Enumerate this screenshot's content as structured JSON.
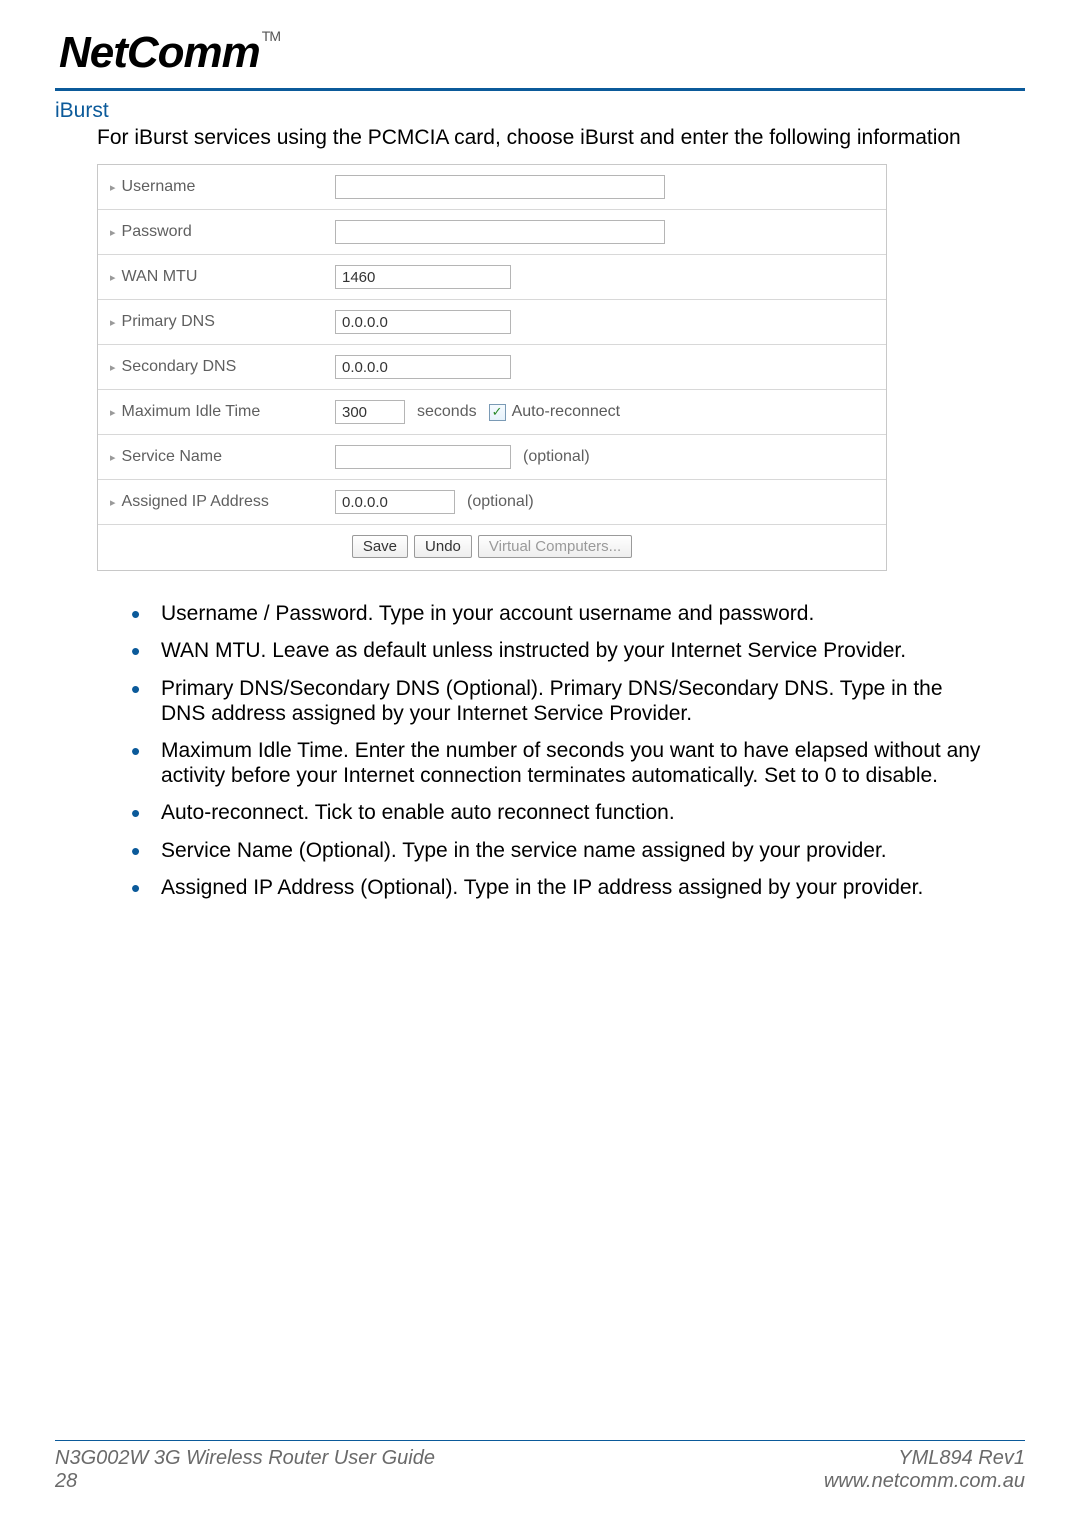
{
  "logo": {
    "text": "NetComm",
    "tm": "TM"
  },
  "section": {
    "title": "iBurst",
    "intro": "For iBurst services using the PCMCIA card, choose iBurst and enter the following information"
  },
  "form": {
    "rows": {
      "username": {
        "label": "Username",
        "value": ""
      },
      "password": {
        "label": "Password",
        "value": ""
      },
      "wan_mtu": {
        "label": "WAN MTU",
        "value": "1460"
      },
      "primary_dns": {
        "label": "Primary DNS",
        "value": "0.0.0.0"
      },
      "secondary_dns": {
        "label": "Secondary DNS",
        "value": "0.0.0.0"
      },
      "max_idle": {
        "label": "Maximum Idle Time",
        "value": "300",
        "suffix": "seconds",
        "checkbox_label": "Auto-reconnect",
        "checked": true
      },
      "service_name": {
        "label": "Service Name",
        "value": "",
        "optional": "(optional)"
      },
      "assigned_ip": {
        "label": "Assigned IP Address",
        "value": "0.0.0.0",
        "optional": "(optional)"
      }
    },
    "buttons": {
      "save": "Save",
      "undo": "Undo",
      "virtual": "Virtual Computers..."
    }
  },
  "bullets": [
    "Username / Password. Type in your account username and password.",
    "WAN MTU. Leave as default unless instructed by your Internet Service Provider.",
    "Primary DNS/Secondary DNS (Optional). Primary DNS/Secondary DNS. Type in the DNS address assigned by your Internet Service Provider.",
    "Maximum Idle Time. Enter the number of seconds you want to have elapsed without any activity before your Internet connection terminates automatically. Set to 0 to disable.",
    "Auto-reconnect. Tick to enable auto reconnect function.",
    "Service Name (Optional). Type in the service name assigned by your provider.",
    "Assigned IP Address (Optional). Type in the IP address assigned by your provider."
  ],
  "footer": {
    "guide": "N3G002W 3G Wireless Router User Guide",
    "page": "28",
    "rev": "YML894 Rev1",
    "url": "www.netcomm.com.au"
  }
}
